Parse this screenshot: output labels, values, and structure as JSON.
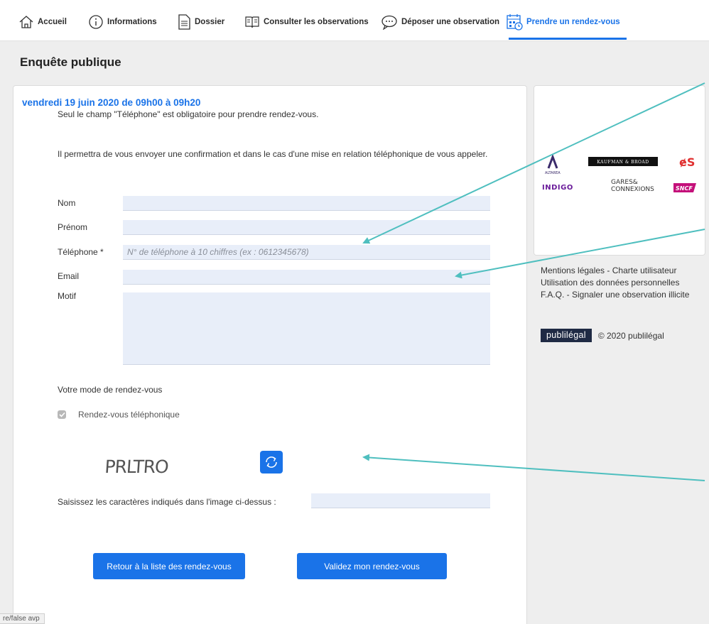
{
  "nav": {
    "items": [
      {
        "label": "Accueil"
      },
      {
        "label": "Informations"
      },
      {
        "label": "Dossier"
      },
      {
        "label": "Consulter les observations"
      },
      {
        "label": "Déposer une observation"
      },
      {
        "label": "Prendre un rendez-vous"
      }
    ],
    "active_index": 5
  },
  "page": {
    "title": "Enquête publique"
  },
  "form": {
    "slot_title": "vendredi 19 juin 2020 de 09h00 à 09h20",
    "intro1": "Seul le champ \"Téléphone\" est obligatoire pour prendre rendez-vous.",
    "intro2": "Il permettra de vous envoyer une confirmation et dans le cas d'une mise en relation téléphonique de vous appeler.",
    "fields": {
      "nom": {
        "label": "Nom",
        "value": ""
      },
      "prenom": {
        "label": "Prénom",
        "value": ""
      },
      "telephone": {
        "label": "Téléphone *",
        "placeholder": "N° de téléphone à 10 chiffres (ex : 0612345678)",
        "value": ""
      },
      "email": {
        "label": "Email",
        "value": ""
      },
      "motif": {
        "label": "Motif",
        "value": ""
      }
    },
    "mode_label": "Votre mode de rendez-vous",
    "mode_option": "Rendez-vous téléphonique",
    "mode_checked": true,
    "captcha_text": "PRLTRO",
    "captcha_label": "Saisissez les caractères indiqués dans l'image ci-dessus :",
    "captcha_value": "",
    "back_button": "Retour à la liste des rendez-vous",
    "validate_button": "Validez mon rendez-vous"
  },
  "sidebar": {
    "partners": {
      "altarea": "ALTAREA",
      "kaufman": "KAUFMAN & BROAD",
      "indigo": "INDIGO",
      "gares_line1": "GARES&",
      "gares_line2": "CONNEXIONS",
      "sncf": "SNCF"
    },
    "links": {
      "mentions": "Mentions légales",
      "charte": "Charte utilisateur",
      "donnees": "Utilisation des données personnelles",
      "faq": "F.A.Q.",
      "signaler": "Signaler une observation illicite"
    },
    "publi_logo": "publilégal",
    "copyright": "© 2020 publilégal"
  },
  "status_bar": {
    "text": "re/false avp"
  },
  "colors": {
    "accent": "#1a73e8",
    "annotation_arrow": "#4fbfbf"
  }
}
